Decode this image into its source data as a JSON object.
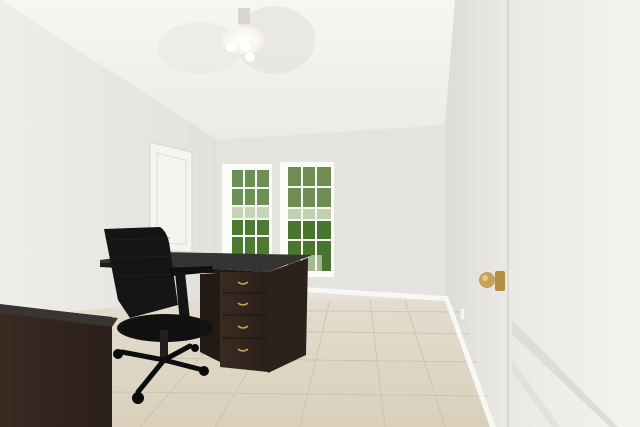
{
  "scene": {
    "kind": "photo",
    "room": "home-office",
    "palette": {
      "ceiling": "#f1f0ec",
      "left_wall": "#e8e7e3",
      "back_wall": "#e3e2de",
      "right_wall": "#e4e3df",
      "floor_tile": "#ddd4c2",
      "grout": "#c6bca8",
      "baseboard": "#f6f6f2",
      "door": "#efefeb",
      "desk_top": "#2f2b28",
      "desk_body": "#3d2d24",
      "chair": "#141414",
      "greenery": "#4d7a32",
      "brass": "#c7a15a"
    },
    "objects": [
      "ceiling-fan",
      "windows",
      "closet-door",
      "desk",
      "office-chair",
      "open-door",
      "side-cabinet",
      "tile-floor"
    ]
  }
}
